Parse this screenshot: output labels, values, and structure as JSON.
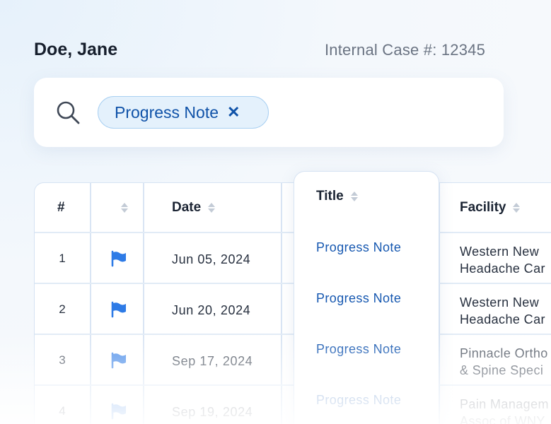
{
  "header": {
    "patient_name": "Doe, Jane",
    "case_number": "Internal Case #: 12345"
  },
  "search": {
    "icon": "search-icon",
    "chips": [
      {
        "label": "Progress Note",
        "close": "✕"
      }
    ]
  },
  "table": {
    "columns": [
      {
        "label": "#"
      },
      {
        "label": "",
        "icon": "sort-icon"
      },
      {
        "label": "Date"
      },
      {
        "label": "Title"
      },
      {
        "label": "Facility"
      }
    ],
    "rows": [
      {
        "num": "1",
        "flag_icon": "flag-icon",
        "date": "Jun 05, 2024",
        "title": "Progress Note",
        "facility_line1": "Western New",
        "facility_line2": "Headache Car"
      },
      {
        "num": "2",
        "flag_icon": "flag-icon",
        "date": "Jun 20, 2024",
        "title": "Progress Note",
        "facility_line1": "Western New",
        "facility_line2": "Headache Car"
      },
      {
        "num": "3",
        "flag_icon": "flag-icon",
        "date": "Sep 17, 2024",
        "title": "Progress Note",
        "facility_line1": "Pinnacle Ortho",
        "facility_line2": "& Spine Speci"
      },
      {
        "num": "4",
        "flag_icon": "flag-icon",
        "date": "Sep 19, 2024",
        "title": "Progress Note",
        "facility_line1": "Pain Managem",
        "facility_line2": "Assoc of WNY"
      }
    ]
  },
  "colors": {
    "accent": "#1557b0",
    "flag": "#2e7be6",
    "chip_bg": "#e4f1fc",
    "chip_border": "#a9d0f2"
  }
}
